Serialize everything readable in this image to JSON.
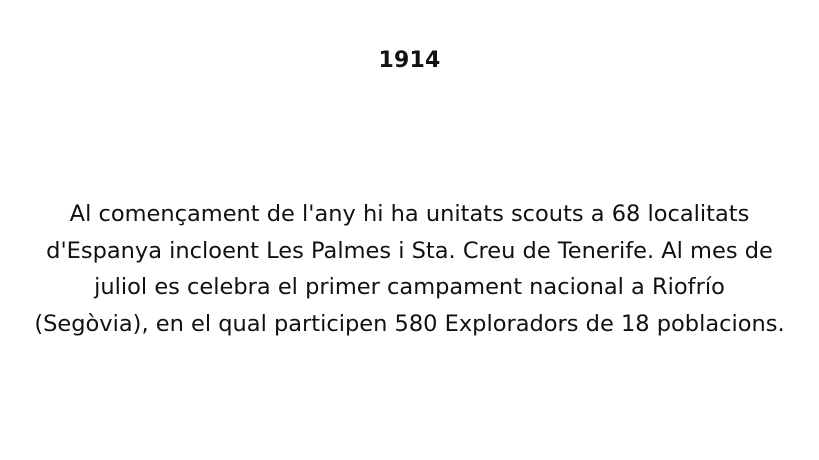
{
  "year": "1914",
  "body": "Al començament de l'any hi ha unitats scouts a 68 localitats d'Espanya incloent Les Palmes i Sta. Creu de Tenerife. Al mes de juliol es celebra el primer campament nacional a Riofrío (Segòvia), en el qual participen 580 Exploradors de 18 poblacions."
}
